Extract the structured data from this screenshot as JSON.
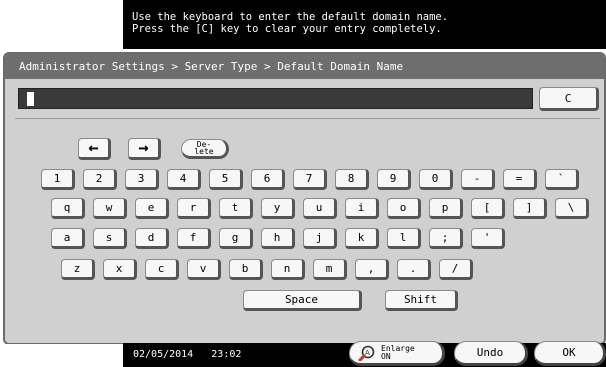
{
  "message": {
    "line1": "Use the keyboard to enter the default domain name.",
    "line2": "Press the [C] key to clear your entry completely."
  },
  "breadcrumb": "Administrator Settings > Server Type > Default Domain Name",
  "entry": {
    "value": ""
  },
  "clear_label": "C",
  "keyboard": {
    "left_arrow": "←",
    "right_arrow": "→",
    "delete_line1": "De-",
    "delete_line2": "lete",
    "row1": [
      "1",
      "2",
      "3",
      "4",
      "5",
      "6",
      "7",
      "8",
      "9",
      "0",
      "-",
      "=",
      "`"
    ],
    "row2": [
      "q",
      "w",
      "e",
      "r",
      "t",
      "y",
      "u",
      "i",
      "o",
      "p",
      "[",
      "]",
      "\\"
    ],
    "row3": [
      "a",
      "s",
      "d",
      "f",
      "g",
      "h",
      "j",
      "k",
      "l",
      ";",
      "'"
    ],
    "row4": [
      "z",
      "x",
      "c",
      "v",
      "b",
      "n",
      "m",
      ",",
      ".",
      "/"
    ],
    "space": "Space",
    "shift": "Shift"
  },
  "footer": {
    "date": "02/05/2014",
    "time": "23:02",
    "enlarge_line1": "Enlarge",
    "enlarge_line2": "ON",
    "undo": "Undo",
    "ok": "OK"
  }
}
